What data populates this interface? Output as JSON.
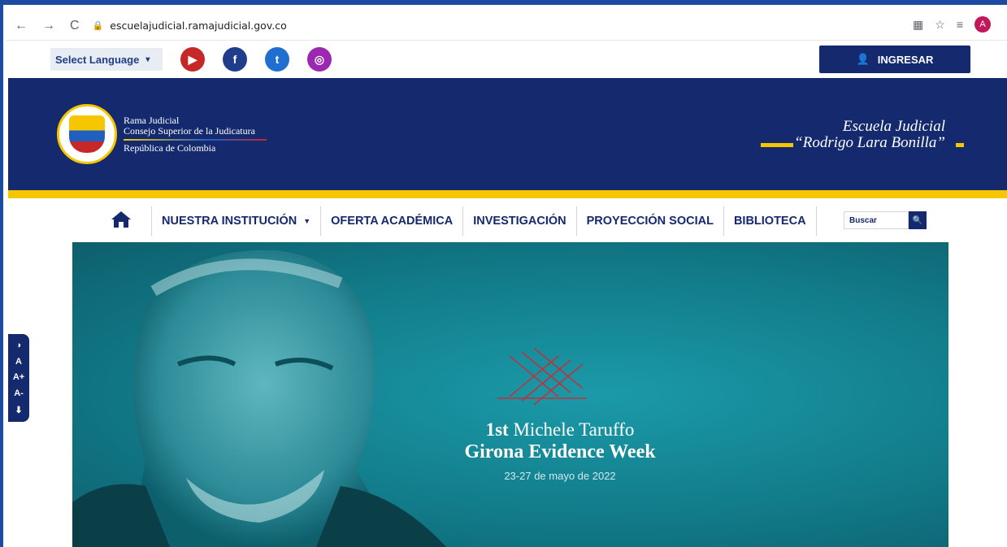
{
  "browser": {
    "url": "escuelajudicial.ramajudicial.gov.co",
    "profile_initial": "A"
  },
  "topbar": {
    "language_label": "Select Language",
    "ingresar_label": "INGRESAR"
  },
  "banner": {
    "rama_line1": "Rama Judicial",
    "rama_line2": "Consejo Superior de la Judicatura",
    "rama_line3": "República de Colombia",
    "escuela_line1": "Escuela Judicial",
    "escuela_line2": "“Rodrigo Lara Bonilla”"
  },
  "menu": {
    "items": [
      {
        "label": "NUESTRA INSTITUCIÓN"
      },
      {
        "label": "OFERTA ACADÉMICA"
      },
      {
        "label": "INVESTIGACIÓN"
      },
      {
        "label": "PROYECCIÓN SOCIAL"
      },
      {
        "label": "BIBLIOTECA"
      }
    ],
    "search_label": "Buscar"
  },
  "hero": {
    "title_prefix": "1st",
    "title_rest": "Michele Taruffo",
    "title_line2": "Girona Evidence Week",
    "date": "23-27 de mayo de 2022"
  },
  "accessibility": {
    "items": [
      "A",
      "A+",
      "A-"
    ]
  },
  "colors": {
    "navy": "#14296e",
    "gold": "#f6c700",
    "teal": "#127c8a"
  }
}
